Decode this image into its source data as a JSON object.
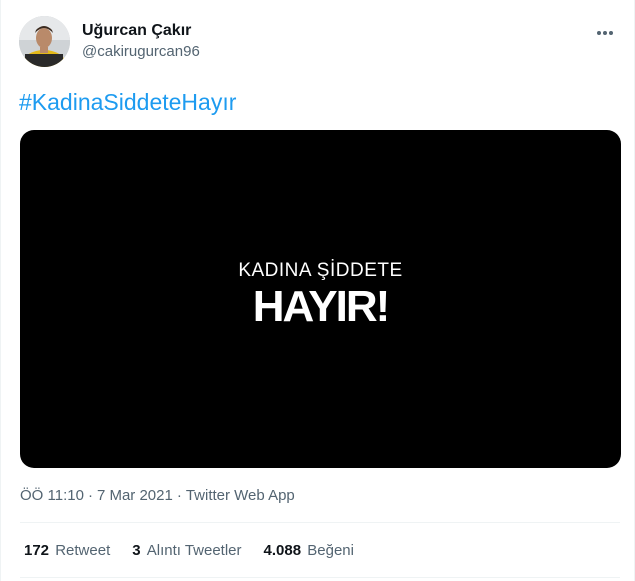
{
  "author": {
    "display_name": "Uğurcan Çakır",
    "handle": "@cakirugurcan96"
  },
  "tweet": {
    "hashtag": "#KadinaSiddeteHayır",
    "media": {
      "line1": "KADINA ŞİDDETE",
      "line2": "HAYIR!"
    },
    "time": "ÖÖ 11:10",
    "date": "7 Mar 2021",
    "source": "Twitter Web App",
    "separator": "·"
  },
  "stats": [
    {
      "count": "172",
      "label": "Retweet"
    },
    {
      "count": "3",
      "label": "Alıntı Tweetler"
    },
    {
      "count": "4.088",
      "label": "Beğeni"
    }
  ],
  "colors": {
    "link": "#1d9bf0",
    "secondary_text": "#536471",
    "media_bg": "#000000"
  },
  "icons": {
    "more": "more-dots-icon"
  }
}
